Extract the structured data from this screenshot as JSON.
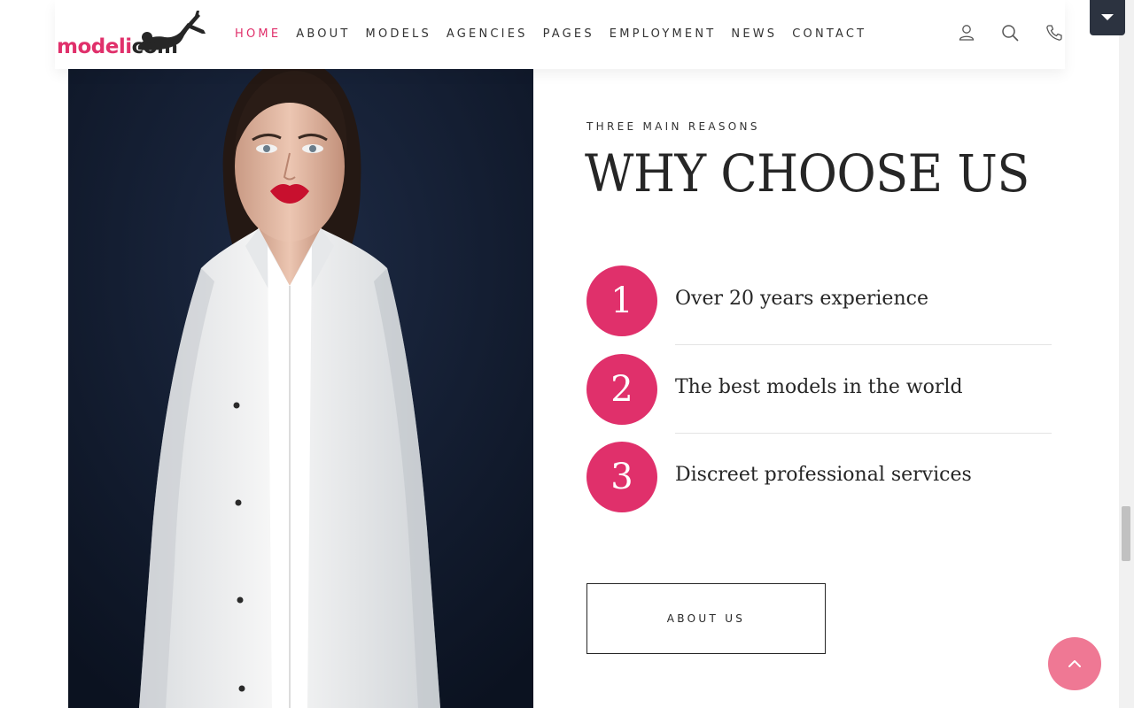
{
  "logo": {
    "part1": "modeli",
    "part2": "com"
  },
  "nav": {
    "items": [
      {
        "label": "HOME",
        "active": true
      },
      {
        "label": "ABOUT",
        "active": false
      },
      {
        "label": "MODELS",
        "active": false
      },
      {
        "label": "AGENCIES",
        "active": false
      },
      {
        "label": "PAGES",
        "active": false
      },
      {
        "label": "EMPLOYMENT",
        "active": false
      },
      {
        "label": "NEWS",
        "active": false
      },
      {
        "label": "CONTACT",
        "active": false
      }
    ]
  },
  "header_icons": [
    "user-icon",
    "search-icon",
    "phone-icon"
  ],
  "section": {
    "eyebrow": "THREE MAIN REASONS",
    "title": "WHY CHOOSE US",
    "reasons": [
      {
        "number": "1",
        "text": "Over 20 years experience"
      },
      {
        "number": "2",
        "text": "The best models in the world"
      },
      {
        "number": "3",
        "text": "Discreet professional services"
      }
    ],
    "button_label": "ABOUT US"
  },
  "colors": {
    "accent": "#e0306b",
    "accent_light": "#ef7894",
    "text": "#262626",
    "photo_bg": "#121a2b",
    "dropdown_bg": "#2c3340"
  }
}
